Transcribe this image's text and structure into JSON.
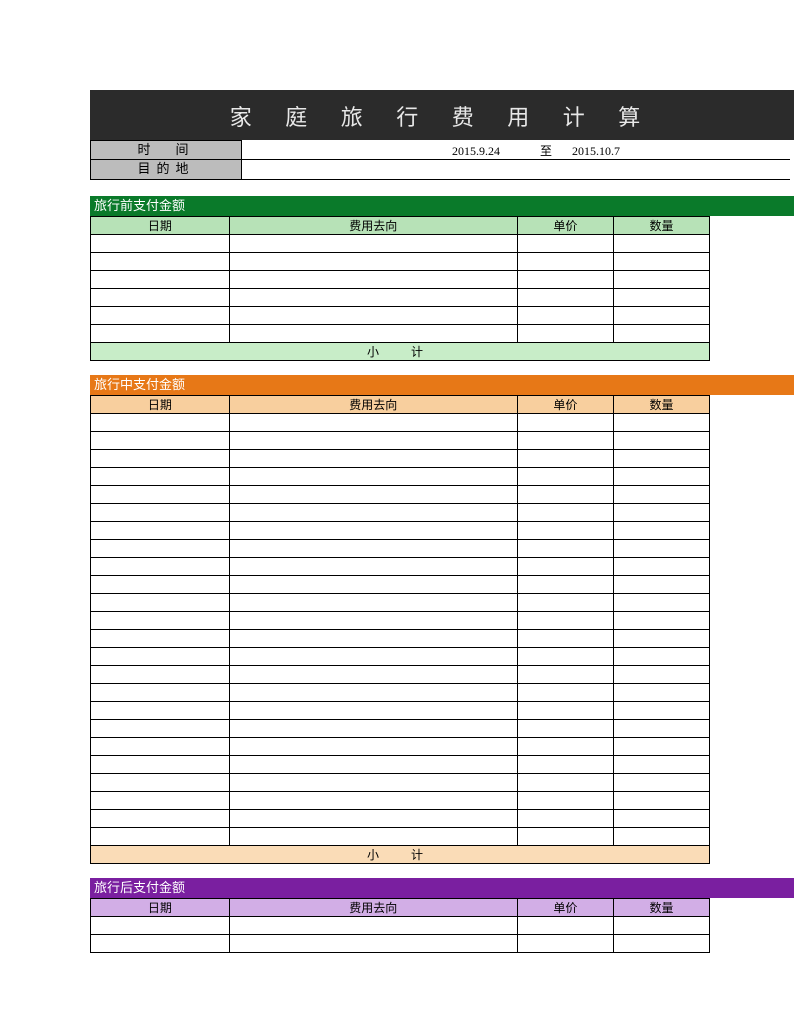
{
  "title": "家 庭 旅 行 费 用 计 算",
  "meta": {
    "time_label": "时　间",
    "dest_label": "目的地",
    "date_start": "2015.9.24",
    "date_sep": "至",
    "date_end": "2015.10.7"
  },
  "columns": {
    "date": "日期",
    "item": "费用去向",
    "price": "单价",
    "qty": "数量"
  },
  "sections": {
    "pre": {
      "title": "旅行前支付金额",
      "rows": 6,
      "subtotal": "小　计"
    },
    "mid": {
      "title": "旅行中支付金额",
      "rows": 24,
      "subtotal": "小　计"
    },
    "post": {
      "title": "旅行后支付金额",
      "rows": 2
    }
  }
}
